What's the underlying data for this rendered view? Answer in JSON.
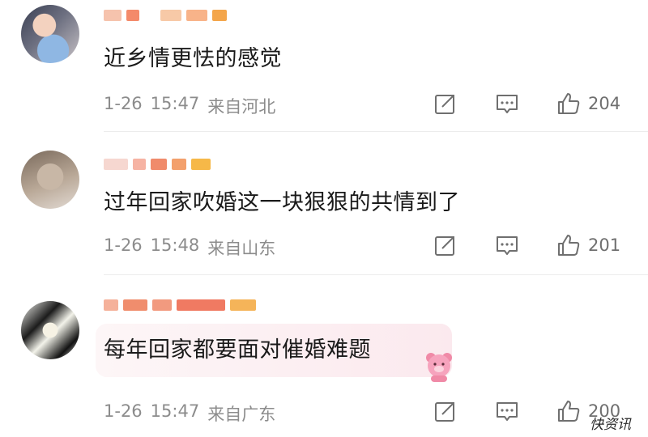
{
  "comments": [
    {
      "text": "近乡情更怯的感觉",
      "date": "1-26",
      "time": "15:47",
      "location": "来自河北",
      "likes": "204",
      "name_colors": [
        "#f6c3ad",
        "#f48a6a",
        "#f7c9a7",
        "#f8b389",
        "#f4a64b"
      ]
    },
    {
      "text": "过年回家吹婚这一块狠狠的共情到了",
      "date": "1-26",
      "time": "15:48",
      "location": "来自山东",
      "likes": "201",
      "name_colors": [
        "#f6d7d0",
        "#f6b3a3",
        "#f08b6b",
        "#f3a06c",
        "#f6b848"
      ]
    },
    {
      "text": "每年回家都要面对催婚难题",
      "date": "1-26",
      "time": "15:47",
      "location": "来自广东",
      "likes": "200",
      "name_colors": [
        "#f5b19a",
        "#f08d6d",
        "#f29a7f",
        "#f07a62",
        "#f5b459"
      ]
    }
  ],
  "icons": {
    "share": "share-icon",
    "reply": "comment-icon",
    "like": "thumbs-up-icon"
  },
  "watermark": "快资讯"
}
